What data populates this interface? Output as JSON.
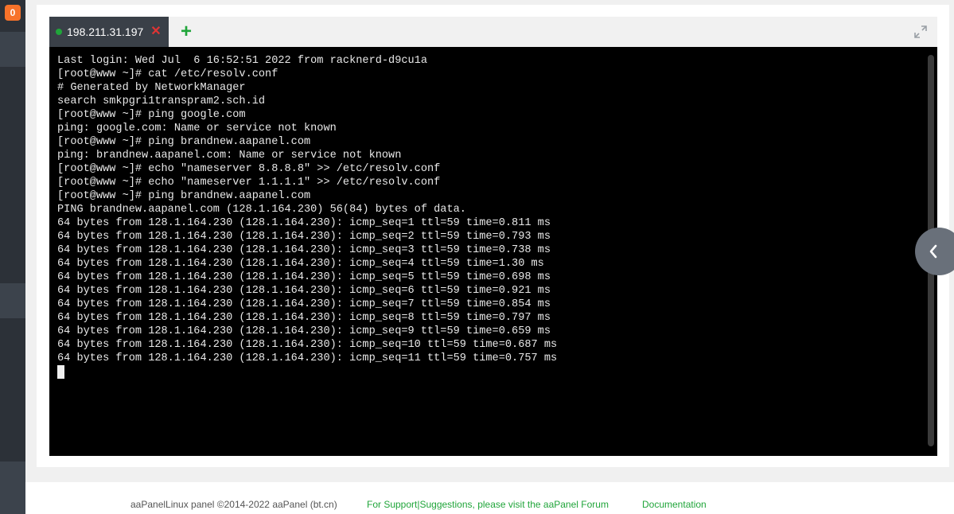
{
  "sidebar": {
    "badge_count": "0"
  },
  "tabs": [
    {
      "label": "198.211.31.197",
      "status_color": "#20a53a",
      "close_symbol": "✕"
    }
  ],
  "add_tab_symbol": "+",
  "terminal": {
    "lines": [
      "Last login: Wed Jul  6 16:52:51 2022 from racknerd-d9cu1a",
      "[root@www ~]# cat /etc/resolv.conf",
      "# Generated by NetworkManager",
      "search smkpgri1transpram2.sch.id",
      "[root@www ~]# ping google.com",
      "ping: google.com: Name or service not known",
      "[root@www ~]# ping brandnew.aapanel.com",
      "ping: brandnew.aapanel.com: Name or service not known",
      "[root@www ~]# echo \"nameserver 8.8.8.8\" >> /etc/resolv.conf",
      "[root@www ~]# echo \"nameserver 1.1.1.1\" >> /etc/resolv.conf",
      "[root@www ~]# ping brandnew.aapanel.com",
      "PING brandnew.aapanel.com (128.1.164.230) 56(84) bytes of data.",
      "64 bytes from 128.1.164.230 (128.1.164.230): icmp_seq=1 ttl=59 time=0.811 ms",
      "64 bytes from 128.1.164.230 (128.1.164.230): icmp_seq=2 ttl=59 time=0.793 ms",
      "64 bytes from 128.1.164.230 (128.1.164.230): icmp_seq=3 ttl=59 time=0.738 ms",
      "64 bytes from 128.1.164.230 (128.1.164.230): icmp_seq=4 ttl=59 time=1.30 ms",
      "64 bytes from 128.1.164.230 (128.1.164.230): icmp_seq=5 ttl=59 time=0.698 ms",
      "64 bytes from 128.1.164.230 (128.1.164.230): icmp_seq=6 ttl=59 time=0.921 ms",
      "64 bytes from 128.1.164.230 (128.1.164.230): icmp_seq=7 ttl=59 time=0.854 ms",
      "64 bytes from 128.1.164.230 (128.1.164.230): icmp_seq=8 ttl=59 time=0.797 ms",
      "64 bytes from 128.1.164.230 (128.1.164.230): icmp_seq=9 ttl=59 time=0.659 ms",
      "64 bytes from 128.1.164.230 (128.1.164.230): icmp_seq=10 ttl=59 time=0.687 ms",
      "64 bytes from 128.1.164.230 (128.1.164.230): icmp_seq=11 ttl=59 time=0.757 ms"
    ]
  },
  "footer": {
    "copyright": "aaPanelLinux panel ©2014-2022 aaPanel (bt.cn)",
    "support_link": "For Support|Suggestions, please visit the aaPanel Forum",
    "docs_link": "Documentation"
  },
  "colors": {
    "accent": "#20a53a",
    "close": "#e03434",
    "badge": "#f7722a",
    "sidebar": "#2c3138",
    "terminal_bg": "#000000"
  },
  "icons": [
    "fullscreen-icon",
    "chevron-left-icon",
    "plus-icon",
    "close-icon"
  ]
}
